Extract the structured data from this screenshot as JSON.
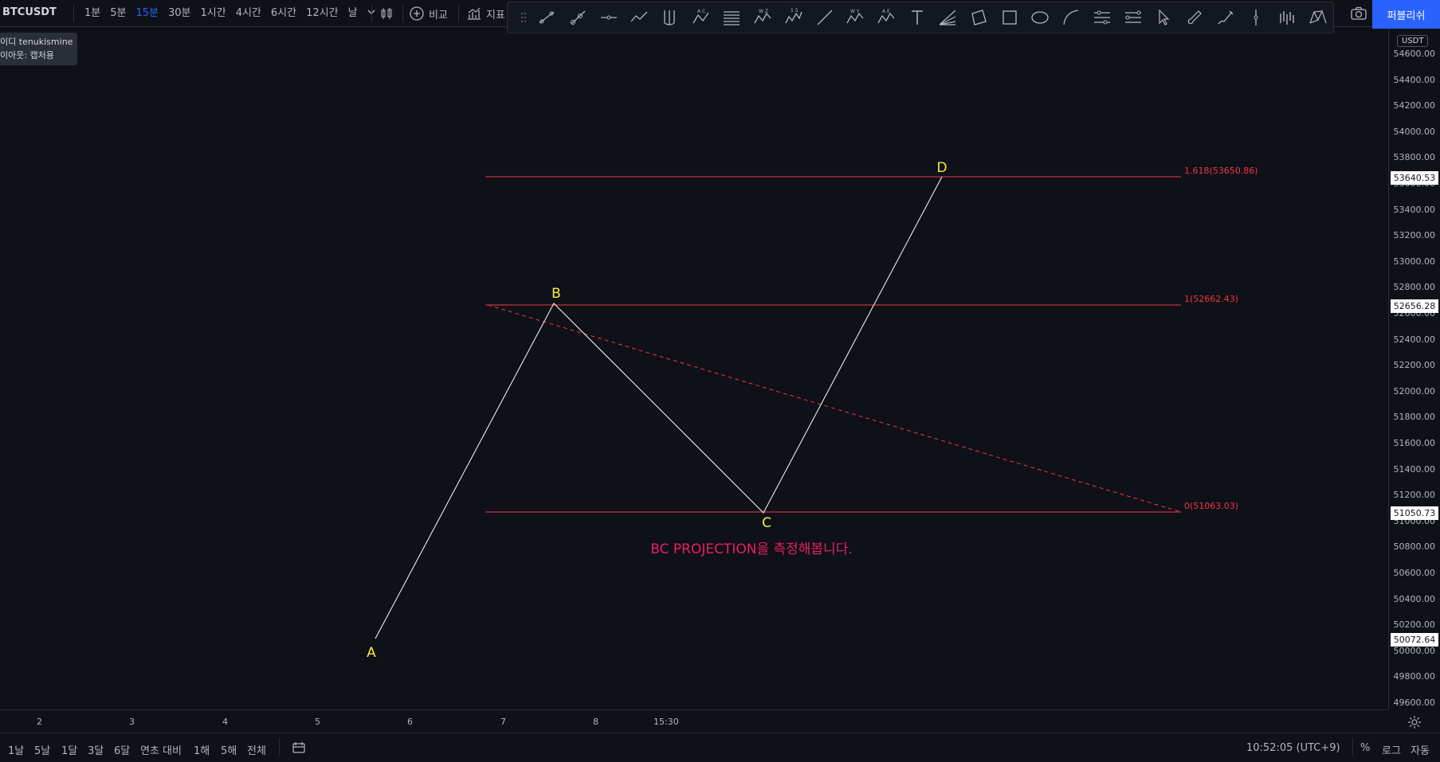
{
  "header": {
    "symbol": "BTCUSDT",
    "timeframes": [
      "1분",
      "5분",
      "15분",
      "30분",
      "1시간",
      "4시간",
      "6시간",
      "12시간",
      "날"
    ],
    "active_timeframe": "15분",
    "compare_label": "비교",
    "indicators_label": "지표",
    "publish_label": "퍼블리쉬"
  },
  "legend": {
    "line1": "이디 tenukismine",
    "line2": "이아웃: 캡처용"
  },
  "drawing": {
    "points": {
      "a": "A",
      "b": "B",
      "c": "C",
      "d": "D"
    },
    "levels": {
      "l1618": "1.618(53650.86)",
      "l1": "1(52662.43)",
      "l0": "0(51063.03)"
    },
    "annotation": "BC PROJECTION을 측정해봅니다."
  },
  "price_scale": {
    "currency": "USDT",
    "ticks": [
      "54600.00",
      "54400.00",
      "54200.00",
      "54000.00",
      "53800.00",
      "53600.00",
      "53400.00",
      "53200.00",
      "53000.00",
      "52800.00",
      "52600.00",
      "52400.00",
      "52200.00",
      "52000.00",
      "51800.00",
      "51600.00",
      "51400.00",
      "51200.00",
      "51000.00",
      "50800.00",
      "50600.00",
      "50400.00",
      "50200.00",
      "50000.00",
      "49800.00",
      "49600.00"
    ],
    "labels": {
      "l1618": "53640.53",
      "l1": "52656.28",
      "l0": "51050.73",
      "a": "50072.64"
    }
  },
  "time_axis": {
    "ticks": [
      "2",
      "3",
      "4",
      "5",
      "6",
      "7",
      "8",
      "15:30"
    ]
  },
  "bottom_bar": {
    "ranges": [
      "1날",
      "5날",
      "1달",
      "3달",
      "6달",
      "연초 대비",
      "1해",
      "5해",
      "전체"
    ],
    "clock": "10:52:05 (UTC+9)",
    "percent": "%",
    "log": "로그",
    "auto": "자동"
  },
  "colors": {
    "background": "#0e1117",
    "level_line": "#f23645",
    "point_label": "#ffeb3b",
    "annotation": "#e91e63",
    "accent": "#2962ff"
  }
}
